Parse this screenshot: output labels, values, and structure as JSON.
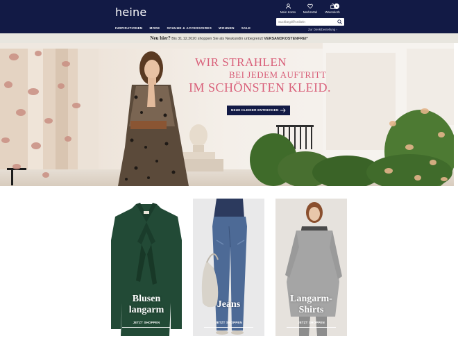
{
  "header": {
    "logo": "heine",
    "nav": [
      "INSPIRATIONEN",
      "MODE",
      "SCHUHE & ACCESSOIRES",
      "WOHNEN",
      "SALE"
    ],
    "account_label": "Mein Konto",
    "wishlist_label": "Merkzettel",
    "cart_label": "Warenkorb",
    "cart_count": "1",
    "search_placeholder": "Suchbegriff/Artikeln",
    "direct_order": "Zur Direktbestellung ›"
  },
  "promo": {
    "lead": "Neu hier?",
    "text": " Bis 31.12.2020 shoppen Sie als Neukundin unbegrenzt ",
    "highlight": "VERSANDKOSTENFREI*"
  },
  "hero": {
    "line1": "WIR STRAHLEN",
    "line2": "BEI JEDEM AUFTRITT",
    "line3": "IM SCHÖNSTEN KLEID.",
    "button_label": "NEUE KLEIDER ENTDECKEN"
  },
  "categories": [
    {
      "title_1": "Blusen",
      "title_2": "langarm",
      "cta": "JETZT SHOPPEN"
    },
    {
      "title_1": "Jeans",
      "title_2": "",
      "cta": "JETZT SHOPPEN"
    },
    {
      "title_1": "Langarm-",
      "title_2": "Shirts",
      "cta": "JETZT SHOPPEN"
    }
  ],
  "colors": {
    "header_bg": "#121a45",
    "headline": "#d9607a",
    "promo_bg": "#e8e6df"
  },
  "icons": [
    "user-icon",
    "heart-icon",
    "bag-icon",
    "search-icon",
    "arrow-right-icon"
  ]
}
